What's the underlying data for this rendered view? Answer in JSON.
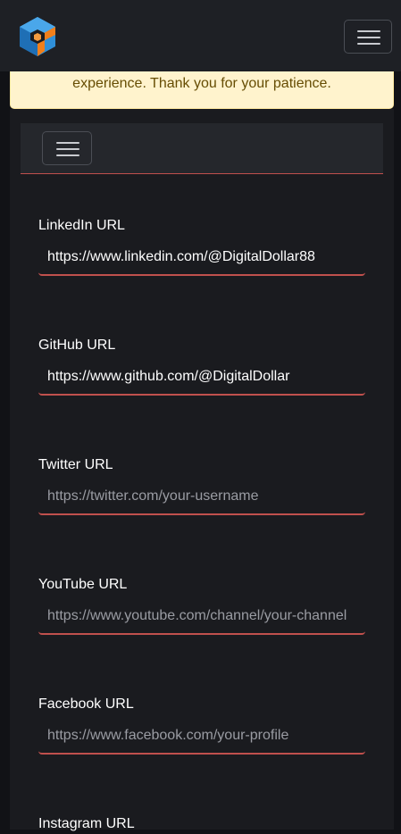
{
  "alert": {
    "text": "experience. Thank you for your patience."
  },
  "fields": [
    {
      "label": "LinkedIn URL",
      "value": "https://www.linkedin.com/@DigitalDollar88",
      "placeholder": ""
    },
    {
      "label": "GitHub URL",
      "value": "https://www.github.com/@DigitalDollar",
      "placeholder": ""
    },
    {
      "label": "Twitter URL",
      "value": "",
      "placeholder": "https://twitter.com/your-username"
    },
    {
      "label": "YouTube URL",
      "value": "",
      "placeholder": "https://www.youtube.com/channel/your-channel"
    },
    {
      "label": "Facebook URL",
      "value": "",
      "placeholder": "https://www.facebook.com/your-profile"
    },
    {
      "label": "Instagram URL"
    }
  ],
  "icons": {
    "logo": "brand-logo-icon",
    "menu": "hamburger-menu-icon"
  },
  "colors": {
    "accent": "#c0504d",
    "logo_blue": "#2f8fd8",
    "logo_orange": "#f07f1b"
  }
}
